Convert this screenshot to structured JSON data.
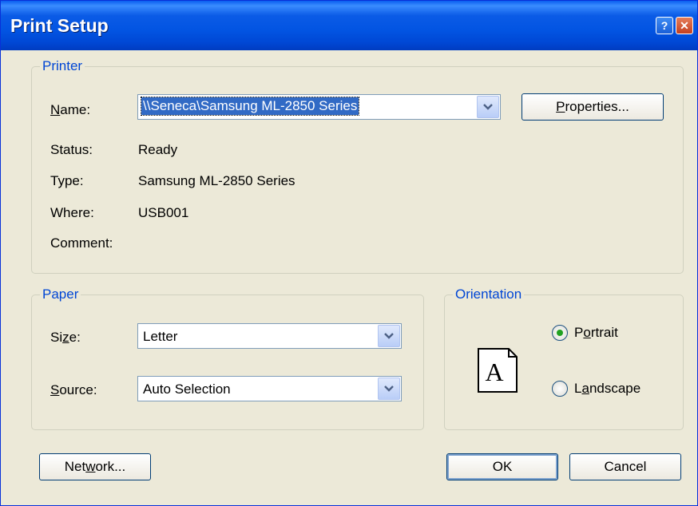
{
  "window": {
    "title": "Print Setup",
    "help_glyph": "?",
    "close_glyph": "✕"
  },
  "printer": {
    "legend": "Printer",
    "name_label": "Name:",
    "name_value": "\\\\Seneca\\Samsung ML-2850 Series",
    "properties_button": "Properties...",
    "status_label": "Status:",
    "status_value": "Ready",
    "type_label": "Type:",
    "type_value": "Samsung ML-2850 Series",
    "where_label": "Where:",
    "where_value": "USB001",
    "comment_label": "Comment:",
    "comment_value": ""
  },
  "paper": {
    "legend": "Paper",
    "size_label": "Size:",
    "size_value": "Letter",
    "source_label": "Source:",
    "source_value": "Auto Selection"
  },
  "orientation": {
    "legend": "Orientation",
    "page_glyph": "A",
    "portrait_label": "Portrait",
    "landscape_label": "Landscape",
    "selected": "Portrait"
  },
  "footer": {
    "network_button": "Network...",
    "ok_button": "OK",
    "cancel_button": "Cancel"
  },
  "icons": {
    "help": "help-icon",
    "close": "close-icon",
    "dropdown": "chevron-down-icon",
    "orientation": "portrait-page-icon"
  },
  "colors": {
    "title_bar": "#0054e3",
    "dialog_bg": "#ece9d8",
    "group_label": "#0046d5",
    "selection": "#316ac5"
  }
}
